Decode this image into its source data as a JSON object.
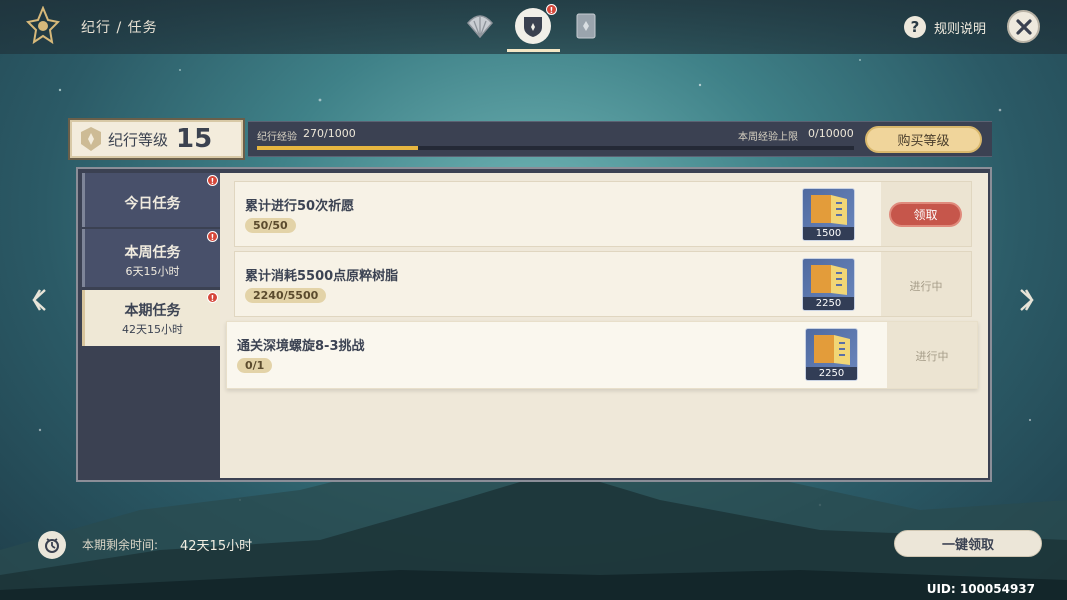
{
  "header": {
    "breadcrumb": "纪行 / 任务",
    "tabs": [
      {
        "icon": "shell-icon",
        "active": false
      },
      {
        "icon": "shield-icon",
        "active": true,
        "alert": "!"
      },
      {
        "icon": "card-icon",
        "active": false
      }
    ],
    "help_label": "规则说明",
    "close_icon": "close-icon"
  },
  "level": {
    "label": "纪行等级",
    "value": "15",
    "exp_label": "纪行经验",
    "exp_value": "270/1000",
    "exp_progress": 0.27,
    "weekly_cap_label": "本周经验上限",
    "weekly_cap_value": "0/10000",
    "buy_label": "购买等级"
  },
  "sidebar": {
    "items": [
      {
        "label": "今日任务",
        "sub": "",
        "alert": "!"
      },
      {
        "label": "本周任务",
        "sub": "6天15小时",
        "alert": "!"
      },
      {
        "label": "本期任务",
        "sub": "42天15小时",
        "alert": "!",
        "active": true
      }
    ]
  },
  "tasks": [
    {
      "title": "累计进行50次祈愿",
      "progress": "50/50",
      "reward_amount": "1500",
      "status": "领取",
      "claimable": true
    },
    {
      "title": "累计消耗5500点原粹树脂",
      "progress": "2240/5500",
      "reward_amount": "2250",
      "status": "进行中",
      "claimable": false
    },
    {
      "title": "通关深境螺旋8-3挑战",
      "progress": "0/1",
      "reward_amount": "2250",
      "status": "进行中",
      "claimable": false
    }
  ],
  "footer": {
    "remaining_label": "本期剩余时间:",
    "remaining_value": "42天15小时",
    "claim_all_label": "一键领取",
    "uid": "UID: 100054937"
  },
  "colors": {
    "accent_gold": "#e7b640",
    "claim_red": "#c6564b",
    "panel_dark": "#3b4152",
    "paper": "#efe8d9"
  }
}
